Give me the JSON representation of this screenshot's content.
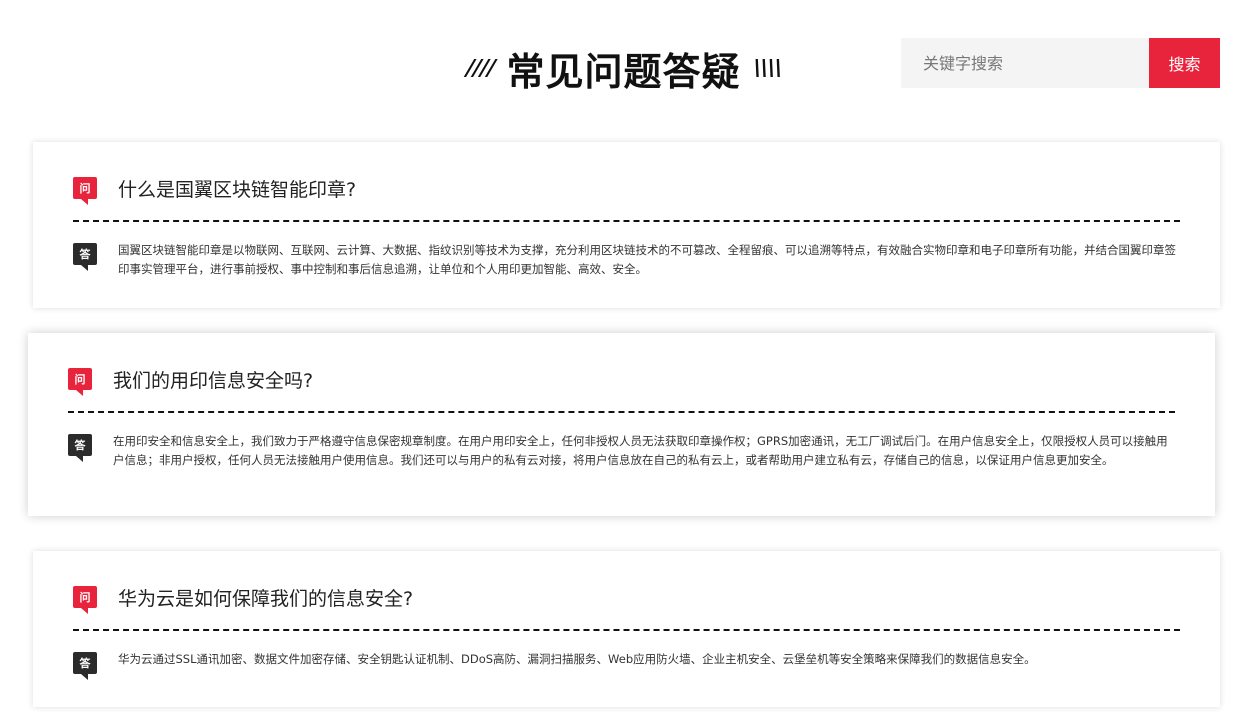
{
  "header": {
    "deco_left": "////",
    "title": "常见问题答疑",
    "deco_right": "\\\\\\\\"
  },
  "search": {
    "placeholder": "关键字搜索",
    "button_label": "搜索"
  },
  "badges": {
    "question": "问",
    "answer": "答"
  },
  "faqs": [
    {
      "question": "什么是国翼区块链智能印章?",
      "answer": "国翼区块链智能印章是以物联网、互联网、云计算、大数据、指纹识别等技术为支撑，充分利用区块链技术的不可篡改、全程留痕、可以追溯等特点，有效融合实物印章和电子印章所有功能，并结合国翼印章签印事实管理平台，进行事前授权、事中控制和事后信息追溯，让单位和个人用印更加智能、高效、安全。"
    },
    {
      "question": "我们的用印信息安全吗?",
      "answer": "在用印安全和信息安全上，我们致力于严格遵守信息保密规章制度。在用户用印安全上，任何非授权人员无法获取印章操作权；GPRS加密通讯，无工厂调试后门。在用户信息安全上，仅限授权人员可以接触用户信息；非用户授权，任何人员无法接触用户使用信息。我们还可以与用户的私有云对接，将用户信息放在自己的私有云上，或者帮助用户建立私有云，存储自己的信息，以保证用户信息更加安全。"
    },
    {
      "question": "华为云是如何保障我们的信息安全?",
      "answer": "华为云通过SSL通讯加密、数据文件加密存储、安全钥匙认证机制、DDoS高防、漏洞扫描服务、Web应用防火墙、企业主机安全、云堡垒机等安全策略来保障我们的数据信息安全。"
    }
  ],
  "colors": {
    "accent": "#e8243c",
    "answer_badge": "#2b2b2b"
  }
}
